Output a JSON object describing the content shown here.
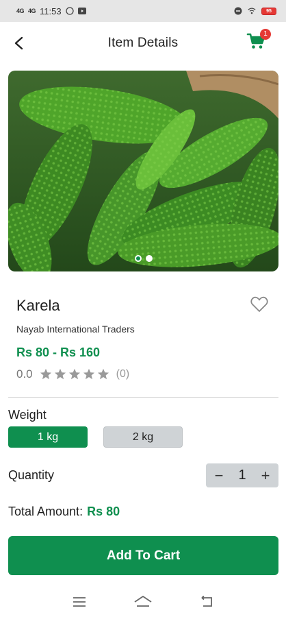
{
  "status_bar": {
    "time": "11:53",
    "signal_1": "4G",
    "signal_2": "4G",
    "battery": "95"
  },
  "header": {
    "title": "Item Details",
    "cart_count": "1",
    "back_icon": "back-arrow-icon",
    "cart_icon": "shopping-cart-icon"
  },
  "carousel": {
    "image_description": "bitter-gourd-photo",
    "active_index": 0,
    "total": 2
  },
  "product": {
    "name": "Karela",
    "vendor": "Nayab International Traders",
    "price_range": "Rs 80 - Rs 160",
    "rating": "0.0",
    "rating_count": "(0)",
    "stars": 0
  },
  "weight": {
    "label": "Weight",
    "options": [
      "1 kg",
      "2 kg"
    ],
    "selected": "1 kg"
  },
  "quantity": {
    "label": "Quantity",
    "value": "1",
    "minus": "−",
    "plus": "+"
  },
  "total": {
    "label": "Total Amount:",
    "value": "Rs 80"
  },
  "cta": {
    "label": "Add To Cart"
  },
  "colors": {
    "accent": "#0f8f4f",
    "badge": "#e53935",
    "chip_inactive": "#cfd3d6"
  }
}
